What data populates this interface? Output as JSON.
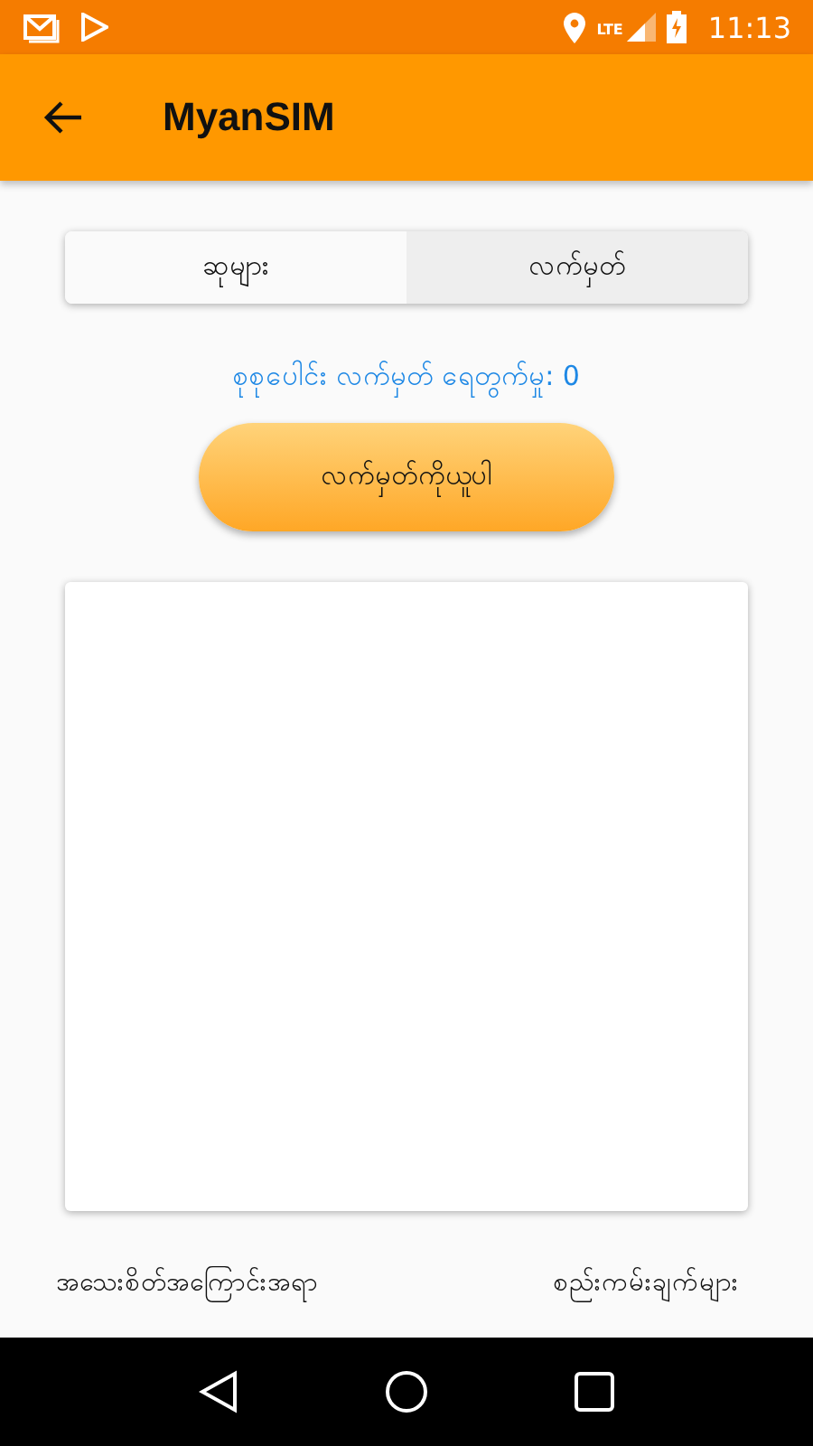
{
  "status_bar": {
    "time": "11:13",
    "network": "LTE"
  },
  "app_bar": {
    "title": "MyanSIM"
  },
  "tabs": [
    {
      "label": "ဆုများ",
      "selected": true
    },
    {
      "label": "လက်မှတ်",
      "selected": false
    }
  ],
  "ticket_count": "စုစုပေါင်း လက်မှတ် ရေတွက်မှု: 0",
  "get_ticket_button": "လက်မှတ်ကိုယူပါ",
  "footer_links": [
    "အသေးစိတ်အကြောင်းအရာ",
    "စည်းကမ်းချက်များ"
  ]
}
